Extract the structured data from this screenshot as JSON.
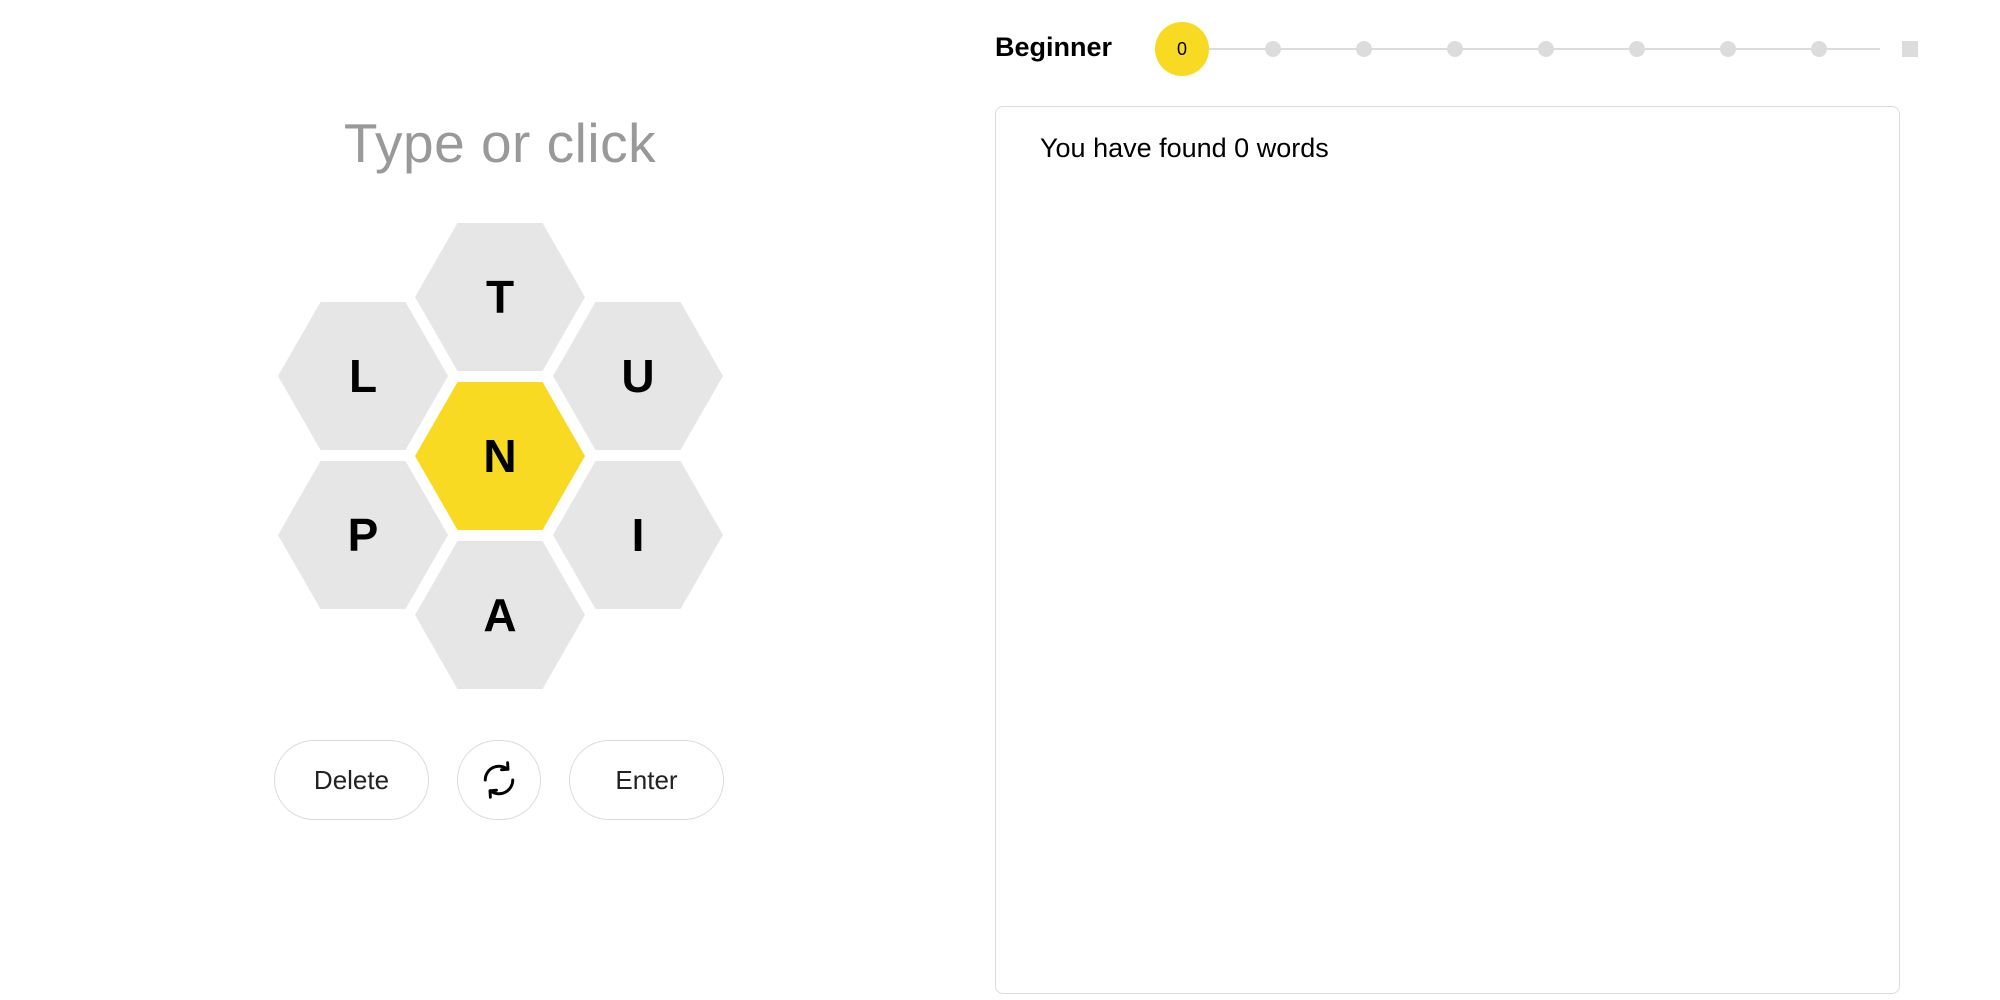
{
  "input": {
    "placeholder": "Type or click"
  },
  "hive": {
    "center_letter": "N",
    "outer_letters": {
      "top": "T",
      "upper_left": "L",
      "upper_right": "U",
      "lower_left": "P",
      "lower_right": "I",
      "bottom": "A"
    }
  },
  "controls": {
    "delete_label": "Delete",
    "shuffle_icon": "shuffle-icon",
    "enter_label": "Enter"
  },
  "progress": {
    "rank": "Beginner",
    "score": "0",
    "total_steps": 9,
    "current_step": 0
  },
  "wordlist": {
    "summary": "You have found 0 words",
    "words": []
  },
  "colors": {
    "accent": "#f7da21",
    "cell": "#e6e6e6",
    "placeholder": "#999999",
    "track": "#dcdcdc"
  }
}
